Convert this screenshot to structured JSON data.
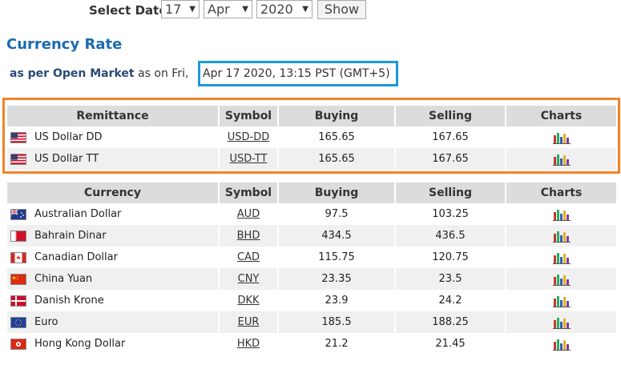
{
  "date_selector": {
    "label": "Select Date",
    "day": "17",
    "month": "Apr",
    "year": "2020",
    "show_label": "Show"
  },
  "page": {
    "title": "Currency Rate",
    "subtitle_bold": "as per Open Market",
    "subtitle_rest": "as on Fri,",
    "date_text": "Apr 17 2020, 13:15 PST (GMT+5)"
  },
  "remittance_table": {
    "headers": [
      "Remittance",
      "Symbol",
      "Buying",
      "Selling",
      "Charts"
    ],
    "rows": [
      {
        "name": "US Dollar DD",
        "symbol": "USD-DD",
        "buying": "165.65",
        "selling": "167.65",
        "flag": "us-flag"
      },
      {
        "name": "US Dollar TT",
        "symbol": "USD-TT",
        "buying": "165.65",
        "selling": "167.65",
        "flag": "us-flag"
      }
    ]
  },
  "currency_table": {
    "headers": [
      "Currency",
      "Symbol",
      "Buying",
      "Selling",
      "Charts"
    ],
    "rows": [
      {
        "name": "Australian Dollar",
        "symbol": "AUD",
        "buying": "97.5",
        "selling": "103.25",
        "flag": "australia-flag"
      },
      {
        "name": "Bahrain Dinar",
        "symbol": "BHD",
        "buying": "434.5",
        "selling": "436.5",
        "flag": "bahrain-flag"
      },
      {
        "name": "Canadian Dollar",
        "symbol": "CAD",
        "buying": "115.75",
        "selling": "120.75",
        "flag": "canada-flag"
      },
      {
        "name": "China Yuan",
        "symbol": "CNY",
        "buying": "23.35",
        "selling": "23.5",
        "flag": "china-flag"
      },
      {
        "name": "Danish Krone",
        "symbol": "DKK",
        "buying": "23.9",
        "selling": "24.2",
        "flag": "denmark-flag"
      },
      {
        "name": "Euro",
        "symbol": "EUR",
        "buying": "185.5",
        "selling": "188.25",
        "flag": "eu-flag"
      },
      {
        "name": "Hong Kong Dollar",
        "symbol": "HKD",
        "buying": "21.2",
        "selling": "21.45",
        "flag": "hongkong-flag"
      }
    ]
  },
  "colors": {
    "title_blue": "#1b6bb1",
    "date_box_border": "#1a9ad9",
    "remittance_box_border": "#f28428",
    "header_bg": "#dcdcdc",
    "alt_row_bg": "#f0f0f0"
  }
}
